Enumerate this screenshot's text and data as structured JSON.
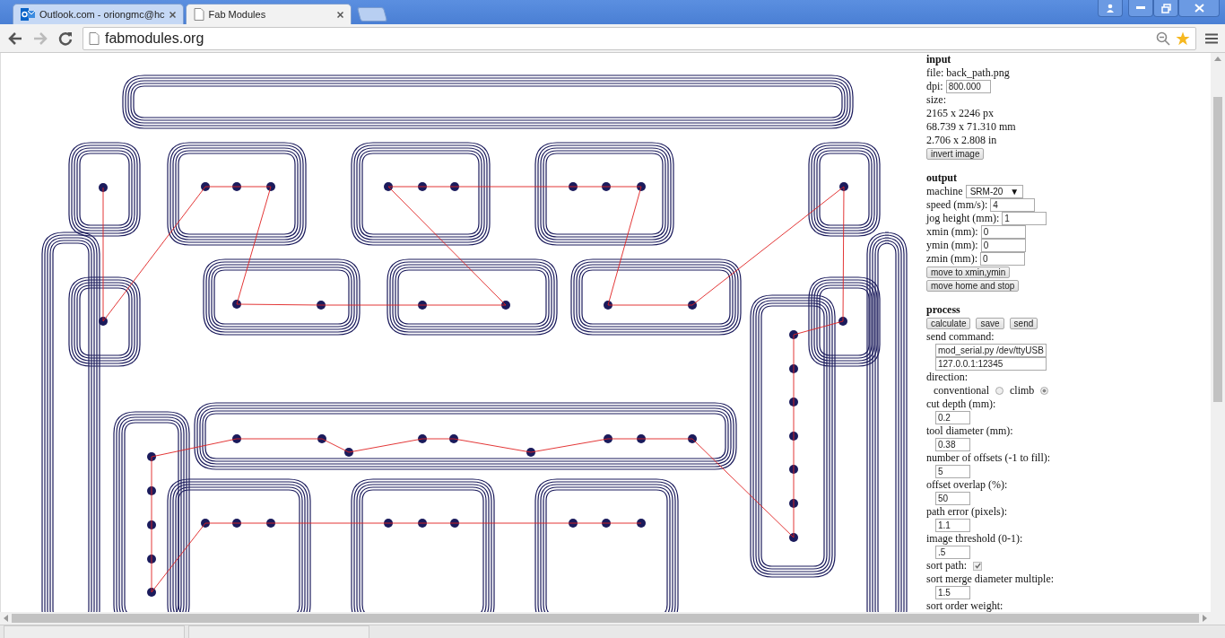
{
  "browser": {
    "tabs": [
      {
        "title": "Outlook.com - oriongmc@hc",
        "selected": false
      },
      {
        "title": "Fab Modules",
        "selected": true
      }
    ],
    "address": "fabmodules.org"
  },
  "panel": {
    "sections": [
      {
        "title": "input",
        "items": [
          {
            "kind": "text",
            "text": "file: back_path.png"
          },
          {
            "kind": "inline_field",
            "label": "dpi:",
            "value": "800.000"
          },
          {
            "kind": "text",
            "text": "size:"
          },
          {
            "kind": "text",
            "text": "2165 x 2246 px"
          },
          {
            "kind": "text",
            "text": "68.739 x 71.310 mm"
          },
          {
            "kind": "text",
            "text": "2.706 x 2.808 in"
          },
          {
            "kind": "buttons",
            "buttons": [
              "invert image"
            ]
          }
        ]
      },
      {
        "title": "output",
        "items": [
          {
            "kind": "select",
            "label": "machine",
            "value": "SRM-20",
            "caret": "▼"
          },
          {
            "kind": "inline_field",
            "label": "speed (mm/s):",
            "value": "4"
          },
          {
            "kind": "inline_field",
            "label": "jog height (mm):",
            "value": "1"
          },
          {
            "kind": "inline_field",
            "label": "xmin (mm):",
            "value": "0"
          },
          {
            "kind": "inline_field",
            "label": "ymin (mm):",
            "value": "0"
          },
          {
            "kind": "inline_field",
            "label": "zmin (mm):",
            "value": "0"
          },
          {
            "kind": "buttons",
            "buttons": [
              "move to xmin,ymin"
            ]
          },
          {
            "kind": "buttons",
            "buttons": [
              "move home and stop"
            ]
          }
        ]
      },
      {
        "title": "process",
        "items": [
          {
            "kind": "buttons",
            "buttons": [
              "calculate",
              "save",
              "send"
            ]
          },
          {
            "kind": "text",
            "text": "send command:"
          },
          {
            "kind": "field",
            "value": "mod_serial.py /dev/ttyUSB",
            "wide": true
          },
          {
            "kind": "field",
            "value": "127.0.0.1:12345",
            "wide": true
          },
          {
            "kind": "text",
            "text": "direction:"
          },
          {
            "kind": "radios",
            "options": [
              {
                "label": "conventional",
                "selected": false
              },
              {
                "label": "climb",
                "selected": true
              }
            ]
          },
          {
            "kind": "text",
            "text": "cut depth (mm):"
          },
          {
            "kind": "field",
            "value": "0.2"
          },
          {
            "kind": "text",
            "text": "tool diameter (mm):"
          },
          {
            "kind": "field",
            "value": "0.38"
          },
          {
            "kind": "text",
            "text": "number of offsets (-1 to fill):"
          },
          {
            "kind": "field",
            "value": "5"
          },
          {
            "kind": "text",
            "text": "offset overlap (%):"
          },
          {
            "kind": "field",
            "value": "50"
          },
          {
            "kind": "text",
            "text": "path error (pixels):"
          },
          {
            "kind": "field",
            "value": "1.1"
          },
          {
            "kind": "text",
            "text": "image threshold (0-1):"
          },
          {
            "kind": "field",
            "value": ".5"
          },
          {
            "kind": "checkbox",
            "label": "sort path:",
            "checked": true
          },
          {
            "kind": "text",
            "text": "sort merge diameter multiple:"
          },
          {
            "kind": "field",
            "value": "1.5"
          },
          {
            "kind": "text",
            "text": "sort order weight:"
          }
        ]
      }
    ]
  }
}
